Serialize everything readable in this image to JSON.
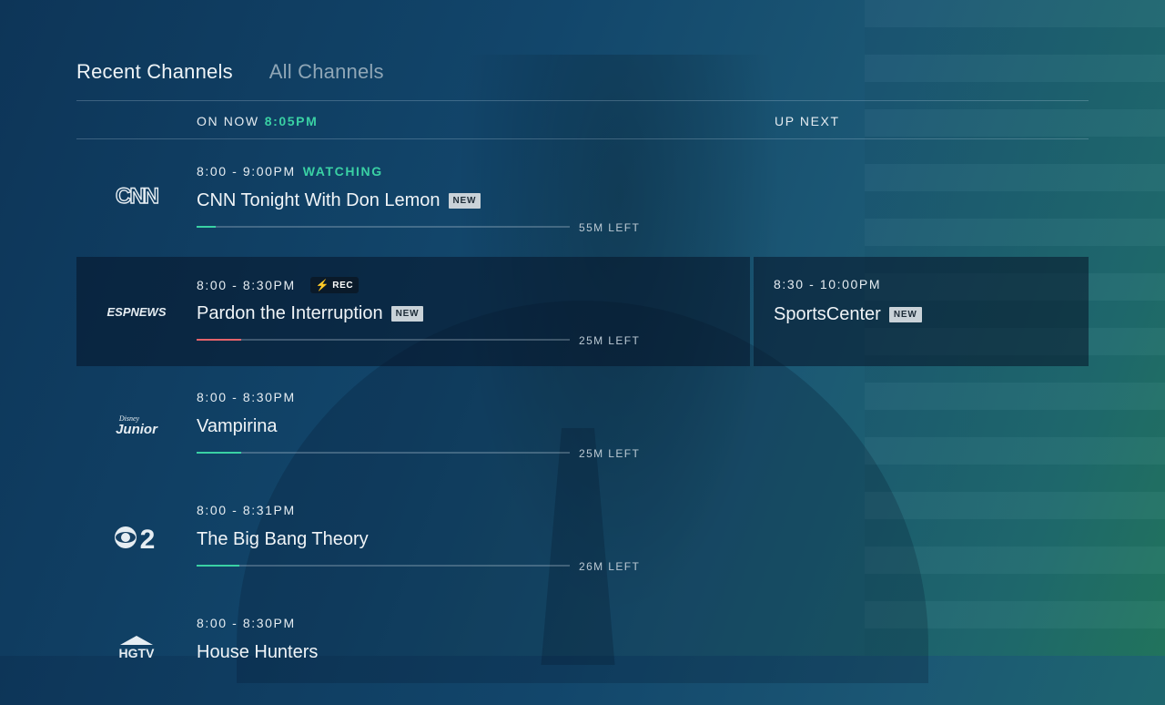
{
  "tabs": [
    {
      "label": "Recent Channels",
      "active": true
    },
    {
      "label": "All Channels",
      "active": false
    }
  ],
  "columns": {
    "on_now_label": "ON NOW",
    "current_time": "8:05PM",
    "up_next_label": "UP NEXT"
  },
  "colors": {
    "accent_green": "#3ad1a4",
    "record_red": "#e5636b"
  },
  "channels": [
    {
      "logo_text": "CNN",
      "time": "8:00 - 9:00PM",
      "status": "WATCHING",
      "title": "CNN Tonight With Don Lemon",
      "badge": "NEW",
      "progress": 0.05,
      "progress_color": "#3ad1a4",
      "time_left": "55M LEFT"
    },
    {
      "logo_text": "ESPNEWS",
      "time": "8:00 - 8:30PM",
      "rec_label": "REC",
      "title": "Pardon the Interruption",
      "badge": "NEW",
      "progress": 0.12,
      "progress_color": "#e5636b",
      "time_left": "25M LEFT",
      "up_next": {
        "time": "8:30 - 10:00PM",
        "title": "SportsCenter",
        "badge": "NEW"
      }
    },
    {
      "logo_text": "Disney Junior",
      "time": "8:00 - 8:30PM",
      "title": "Vampirina",
      "progress": 0.12,
      "progress_color": "#3ad1a4",
      "time_left": "25M LEFT"
    },
    {
      "logo_text": "2",
      "time": "8:00 - 8:31PM",
      "title": "The Big Bang Theory",
      "progress": 0.115,
      "progress_color": "#3ad1a4",
      "time_left": "26M LEFT"
    },
    {
      "logo_text": "HGTV",
      "time": "8:00 - 8:30PM",
      "title": "House Hunters"
    }
  ]
}
